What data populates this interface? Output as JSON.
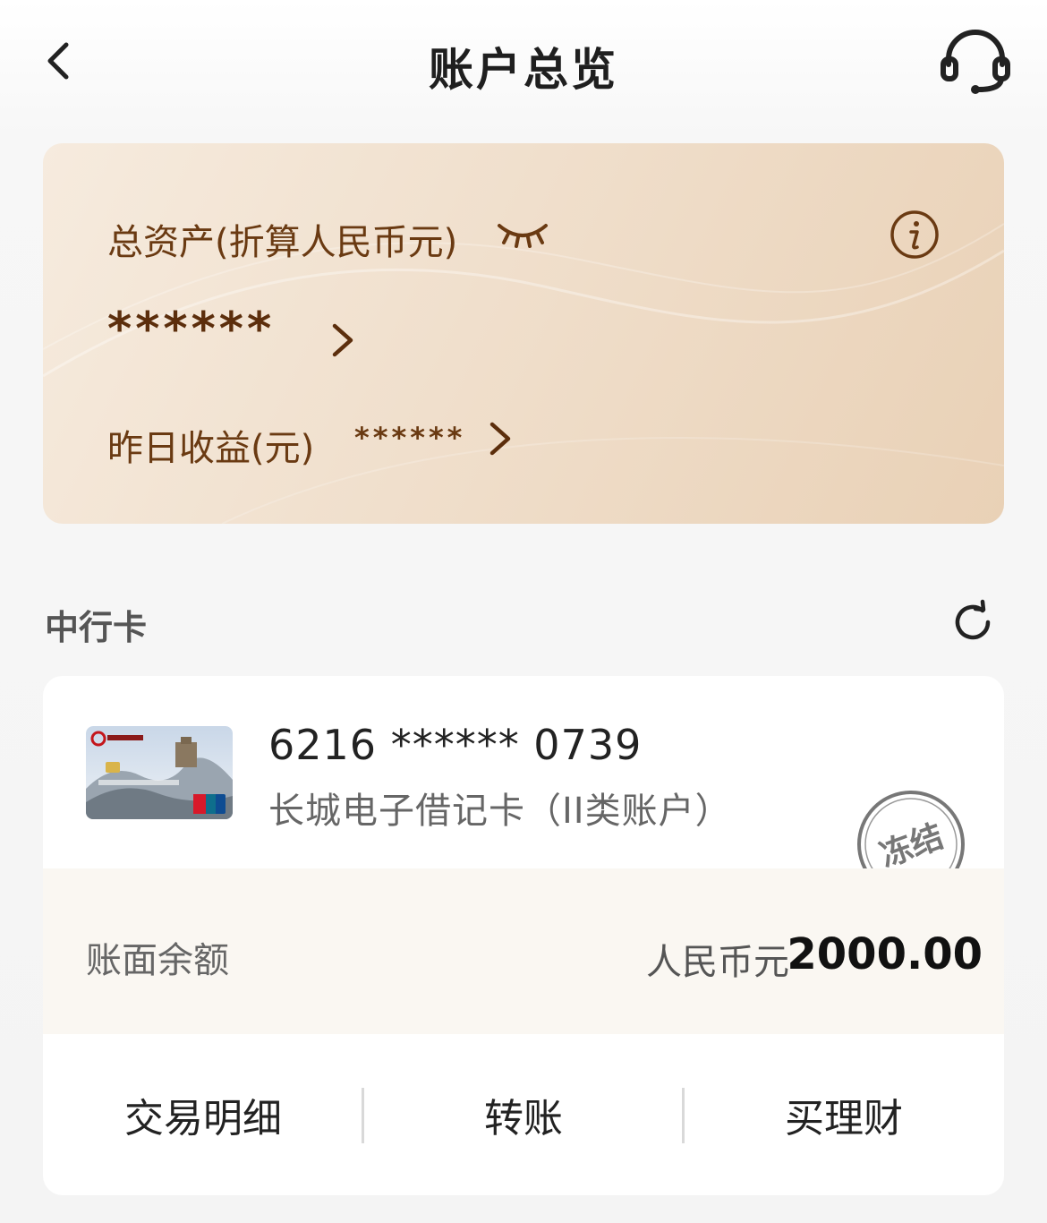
{
  "header": {
    "title": "账户总览",
    "back_icon": "chevron-left-icon",
    "service_icon": "headset-icon"
  },
  "asset_card": {
    "label": "总资产(折算人民币元)",
    "total_masked": "******",
    "yesterday_label": "昨日收益(元)",
    "yesterday_masked": "******",
    "eye_icon": "eye-closed-icon",
    "info_icon": "info-icon",
    "text_color": "#6a3a12"
  },
  "section": {
    "title": "中行卡",
    "refresh_icon": "refresh-icon"
  },
  "account": {
    "card_number": "6216 ****** 0739",
    "card_type": "长城电子借记卡（II类账户）",
    "status": "冻结",
    "balance_label": "账面余额",
    "currency": "人民币元",
    "balance": "2000.00"
  },
  "actions": [
    {
      "label": "交易明细"
    },
    {
      "label": "转账"
    },
    {
      "label": "买理财"
    }
  ]
}
